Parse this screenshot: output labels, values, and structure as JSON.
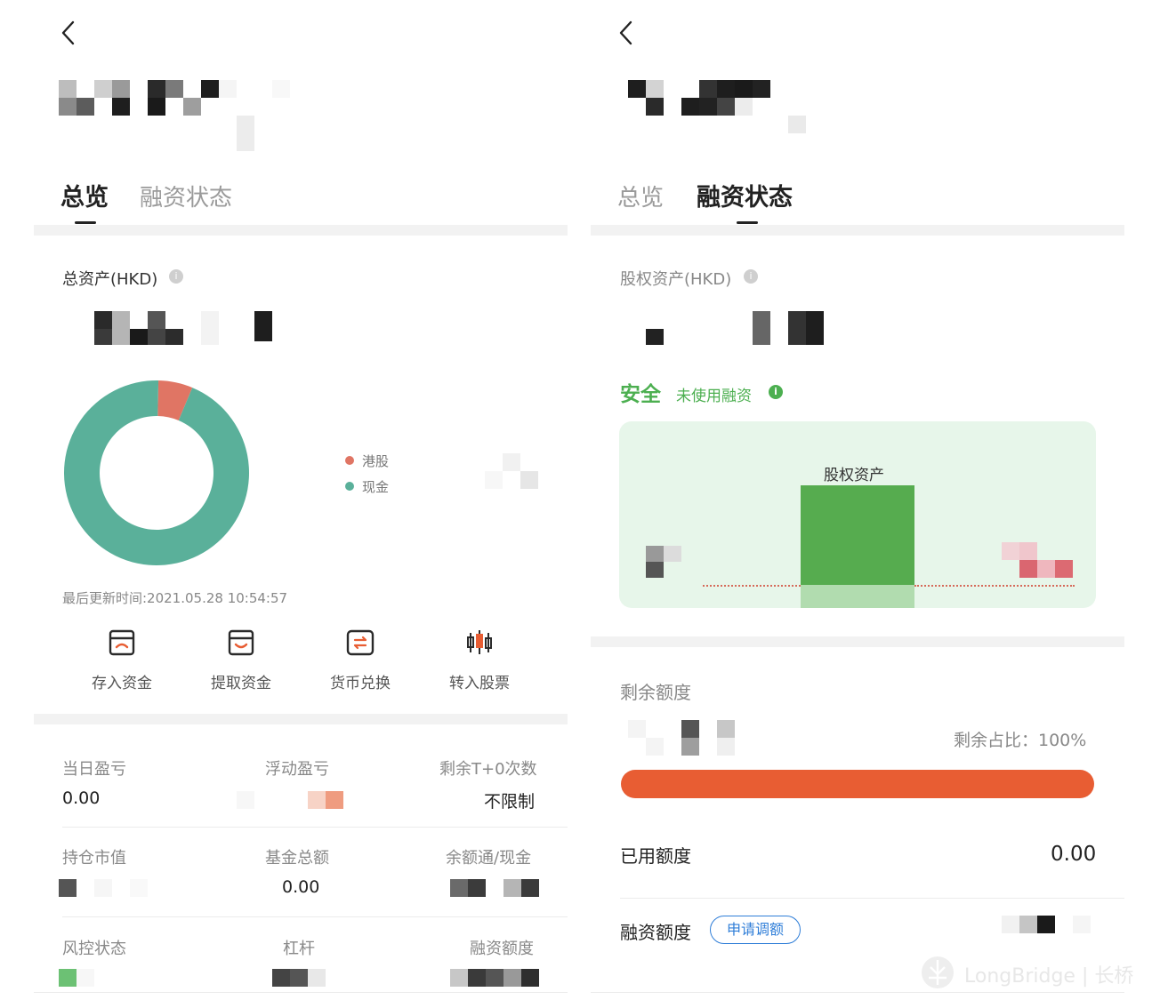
{
  "colors": {
    "accent_green": "#4caf50",
    "donut_teal": "#5ab09a",
    "donut_red": "#e07564",
    "bar_orange": "#e85d33",
    "panel_green": "#e7f6ea",
    "chip_blue": "#2f7ed8"
  },
  "left": {
    "back_icon": "chevron-left-icon",
    "tabs": [
      {
        "label": "总览",
        "active": true
      },
      {
        "label": "融资状态",
        "active": false
      }
    ],
    "total_assets_label": "总资产(HKD)",
    "info_icon": "info-icon",
    "donut": {
      "series": [
        {
          "name": "港股",
          "color": "#e07564",
          "fraction": 0.06
        },
        {
          "name": "现金",
          "color": "#5ab09a",
          "fraction": 0.94
        }
      ]
    },
    "legend": [
      {
        "name": "港股",
        "color": "#e07564"
      },
      {
        "name": "现金",
        "color": "#5ab09a"
      }
    ],
    "updated_text": "最后更新时间:2021.05.28 10:54:57",
    "actions": [
      {
        "label": "存入资金",
        "icon": "deposit-icon"
      },
      {
        "label": "提取资金",
        "icon": "withdraw-icon"
      },
      {
        "label": "货币兑换",
        "icon": "currency-exchange-icon"
      },
      {
        "label": "转入股票",
        "icon": "transfer-stock-icon"
      }
    ],
    "stats": {
      "daily_pnl_label": "当日盈亏",
      "daily_pnl_value": "0.00",
      "float_pnl_label": "浮动盈亏",
      "t0_label": "剩余T+0次数",
      "t0_value": "不限制",
      "holding_label": "持仓市值",
      "fund_label": "基金总额",
      "fund_value": "0.00",
      "cash_label": "余额通/现金",
      "risk_label": "风控状态",
      "leverage_label": "杠杆",
      "margin_label": "融资额度"
    }
  },
  "right": {
    "back_icon": "chevron-left-icon",
    "tabs": [
      {
        "label": "总览",
        "active": false
      },
      {
        "label": "融资状态",
        "active": true
      }
    ],
    "equity_label": "股权资产(HKD)",
    "safety_status": "安全",
    "safety_note": "未使用融资",
    "bar_label": "股权资产",
    "remaining_label": "剩余额度",
    "remaining_ratio": "剩余占比：100%",
    "remaining_fraction": 1.0,
    "used_label": "已用额度",
    "used_value": "0.00",
    "credit_label": "融资额度",
    "apply_button": "申请调额"
  },
  "watermark": "LongBridge | 长桥"
}
